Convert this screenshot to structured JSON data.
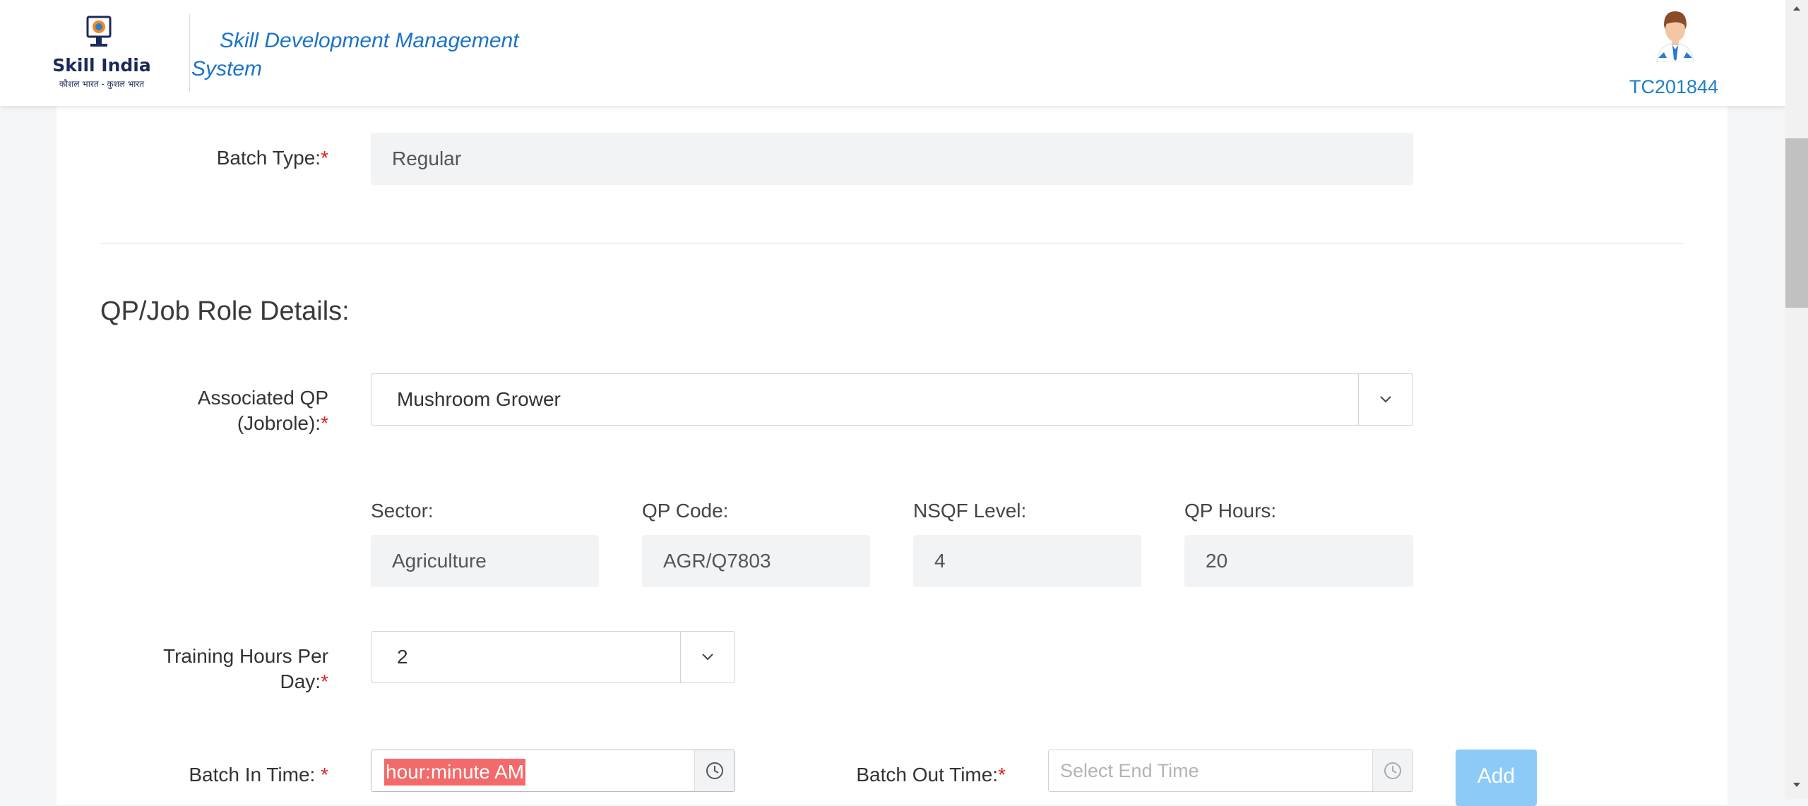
{
  "header": {
    "logo_text": "Skill India",
    "logo_subtext": "कौशल भारत - कुशल भारत",
    "app_title": "Skill Development Management System",
    "user_id": "TC201844"
  },
  "batch_type": {
    "label": "Batch Type:",
    "value": "Regular"
  },
  "qp_section": {
    "title": "QP/Job Role Details:",
    "associated_qp_label_line1": "Associated QP",
    "associated_qp_label_line2": "(Jobrole):",
    "associated_qp_value": "Mushroom Grower",
    "sector_label": "Sector:",
    "sector_value": "Agriculture",
    "qp_code_label": "QP Code:",
    "qp_code_value": "AGR/Q7803",
    "nsqf_label": "NSQF Level:",
    "nsqf_value": "4",
    "qp_hours_label": "QP Hours:",
    "qp_hours_value": "20"
  },
  "training": {
    "label_line1": "Training Hours Per",
    "label_line2": "Day:",
    "value": "2"
  },
  "batch_time": {
    "in_label": "Batch In Time: ",
    "in_placeholder": "hour:minute AM",
    "out_label": "Batch Out Time:",
    "out_placeholder": "Select End Time",
    "add_label": "Add"
  },
  "required_mark": "*",
  "colors": {
    "accent": "#1a73c9",
    "required": "#e02020",
    "add_button": "#8ccaf7",
    "selection": "#f26a6a"
  }
}
